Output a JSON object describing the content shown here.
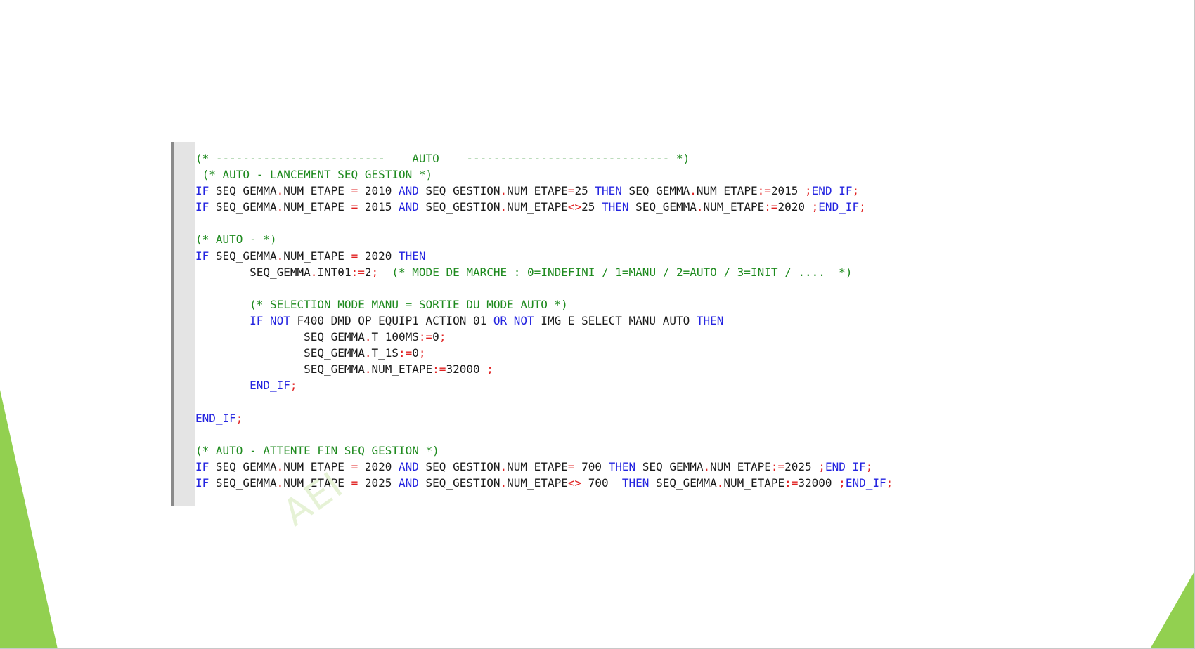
{
  "watermark": "AEI",
  "code_lines": [
    [
      {
        "t": "(* -------------------------    AUTO    ------------------------------ *)",
        "s": "c"
      }
    ],
    [
      {
        "t": " (* AUTO - LANCEMENT SEQ_GESTION *)",
        "s": "c"
      }
    ],
    [
      {
        "t": "IF",
        "s": "k"
      },
      {
        "t": " SEQ_GEMMA",
        "s": "t"
      },
      {
        "t": ".",
        "s": "o"
      },
      {
        "t": "NUM_ETAPE ",
        "s": "t"
      },
      {
        "t": "=",
        "s": "o"
      },
      {
        "t": " 2010 ",
        "s": "t"
      },
      {
        "t": "AND",
        "s": "k"
      },
      {
        "t": " SEQ_GESTION",
        "s": "t"
      },
      {
        "t": ".",
        "s": "o"
      },
      {
        "t": "NUM_ETAPE",
        "s": "t"
      },
      {
        "t": "=",
        "s": "o"
      },
      {
        "t": "25 ",
        "s": "t"
      },
      {
        "t": "THEN",
        "s": "k"
      },
      {
        "t": " SEQ_GEMMA",
        "s": "t"
      },
      {
        "t": ".",
        "s": "o"
      },
      {
        "t": "NUM_ETAPE",
        "s": "t"
      },
      {
        "t": ":=",
        "s": "o"
      },
      {
        "t": "2015 ",
        "s": "t"
      },
      {
        "t": ";",
        "s": "o"
      },
      {
        "t": "END_IF",
        "s": "k"
      },
      {
        "t": ";",
        "s": "o"
      }
    ],
    [
      {
        "t": "IF",
        "s": "k"
      },
      {
        "t": " SEQ_GEMMA",
        "s": "t"
      },
      {
        "t": ".",
        "s": "o"
      },
      {
        "t": "NUM_ETAPE ",
        "s": "t"
      },
      {
        "t": "=",
        "s": "o"
      },
      {
        "t": " 2015 ",
        "s": "t"
      },
      {
        "t": "AND",
        "s": "k"
      },
      {
        "t": " SEQ_GESTION",
        "s": "t"
      },
      {
        "t": ".",
        "s": "o"
      },
      {
        "t": "NUM_ETAPE",
        "s": "t"
      },
      {
        "t": "<>",
        "s": "o"
      },
      {
        "t": "25 ",
        "s": "t"
      },
      {
        "t": "THEN",
        "s": "k"
      },
      {
        "t": " SEQ_GEMMA",
        "s": "t"
      },
      {
        "t": ".",
        "s": "o"
      },
      {
        "t": "NUM_ETAPE",
        "s": "t"
      },
      {
        "t": ":=",
        "s": "o"
      },
      {
        "t": "2020 ",
        "s": "t"
      },
      {
        "t": ";",
        "s": "o"
      },
      {
        "t": "END_IF",
        "s": "k"
      },
      {
        "t": ";",
        "s": "o"
      }
    ],
    [],
    [
      {
        "t": "(* AUTO - *)",
        "s": "c"
      }
    ],
    [
      {
        "t": "IF",
        "s": "k"
      },
      {
        "t": " SEQ_GEMMA",
        "s": "t"
      },
      {
        "t": ".",
        "s": "o"
      },
      {
        "t": "NUM_ETAPE ",
        "s": "t"
      },
      {
        "t": "=",
        "s": "o"
      },
      {
        "t": " 2020 ",
        "s": "t"
      },
      {
        "t": "THEN",
        "s": "k"
      }
    ],
    [
      {
        "t": "        SEQ_GEMMA",
        "s": "t"
      },
      {
        "t": ".",
        "s": "o"
      },
      {
        "t": "INT01",
        "s": "t"
      },
      {
        "t": ":=",
        "s": "o"
      },
      {
        "t": "2",
        "s": "t"
      },
      {
        "t": ";",
        "s": "o"
      },
      {
        "t": "  (* MODE DE MARCHE : 0=INDEFINI / 1=MANU / 2=AUTO / 3=INIT / ....  *)",
        "s": "c"
      }
    ],
    [],
    [
      {
        "t": "        (* SELECTION MODE MANU = SORTIE DU MODE AUTO *)",
        "s": "c"
      }
    ],
    [
      {
        "t": "        IF",
        "s": "k"
      },
      {
        "t": " ",
        "s": "t"
      },
      {
        "t": "NOT",
        "s": "k"
      },
      {
        "t": " F400_DMD_OP_EQUIP1_ACTION_01 ",
        "s": "t"
      },
      {
        "t": "OR",
        "s": "k"
      },
      {
        "t": " ",
        "s": "t"
      },
      {
        "t": "NOT",
        "s": "k"
      },
      {
        "t": " IMG_E_SELECT_MANU_AUTO ",
        "s": "t"
      },
      {
        "t": "THEN",
        "s": "k"
      }
    ],
    [
      {
        "t": "                SEQ_GEMMA",
        "s": "t"
      },
      {
        "t": ".",
        "s": "o"
      },
      {
        "t": "T_100MS",
        "s": "t"
      },
      {
        "t": ":=",
        "s": "o"
      },
      {
        "t": "0",
        "s": "t"
      },
      {
        "t": ";",
        "s": "o"
      }
    ],
    [
      {
        "t": "                SEQ_GEMMA",
        "s": "t"
      },
      {
        "t": ".",
        "s": "o"
      },
      {
        "t": "T_1S",
        "s": "t"
      },
      {
        "t": ":=",
        "s": "o"
      },
      {
        "t": "0",
        "s": "t"
      },
      {
        "t": ";",
        "s": "o"
      }
    ],
    [
      {
        "t": "                SEQ_GEMMA",
        "s": "t"
      },
      {
        "t": ".",
        "s": "o"
      },
      {
        "t": "NUM_ETAPE",
        "s": "t"
      },
      {
        "t": ":=",
        "s": "o"
      },
      {
        "t": "32000 ",
        "s": "t"
      },
      {
        "t": ";",
        "s": "o"
      }
    ],
    [
      {
        "t": "        END_IF",
        "s": "k"
      },
      {
        "t": ";",
        "s": "o"
      }
    ],
    [],
    [
      {
        "t": "END_IF",
        "s": "k"
      },
      {
        "t": ";",
        "s": "o"
      }
    ],
    [],
    [
      {
        "t": "(* AUTO - ATTENTE FIN SEQ_GESTION *)",
        "s": "c"
      }
    ],
    [
      {
        "t": "IF",
        "s": "k"
      },
      {
        "t": " SEQ_GEMMA",
        "s": "t"
      },
      {
        "t": ".",
        "s": "o"
      },
      {
        "t": "NUM_ETAPE ",
        "s": "t"
      },
      {
        "t": "=",
        "s": "o"
      },
      {
        "t": " 2020 ",
        "s": "t"
      },
      {
        "t": "AND",
        "s": "k"
      },
      {
        "t": " SEQ_GESTION",
        "s": "t"
      },
      {
        "t": ".",
        "s": "o"
      },
      {
        "t": "NUM_ETAPE",
        "s": "t"
      },
      {
        "t": "=",
        "s": "o"
      },
      {
        "t": " 700 ",
        "s": "t"
      },
      {
        "t": "THEN",
        "s": "k"
      },
      {
        "t": " SEQ_GEMMA",
        "s": "t"
      },
      {
        "t": ".",
        "s": "o"
      },
      {
        "t": "NUM_ETAPE",
        "s": "t"
      },
      {
        "t": ":=",
        "s": "o"
      },
      {
        "t": "2025 ",
        "s": "t"
      },
      {
        "t": ";",
        "s": "o"
      },
      {
        "t": "END_IF",
        "s": "k"
      },
      {
        "t": ";",
        "s": "o"
      }
    ],
    [
      {
        "t": "IF",
        "s": "k"
      },
      {
        "t": " SEQ_GEMMA",
        "s": "t"
      },
      {
        "t": ".",
        "s": "o"
      },
      {
        "t": "NUM_ETAPE ",
        "s": "t"
      },
      {
        "t": "=",
        "s": "o"
      },
      {
        "t": " 2025 ",
        "s": "t"
      },
      {
        "t": "AND",
        "s": "k"
      },
      {
        "t": " SEQ_GESTION",
        "s": "t"
      },
      {
        "t": ".",
        "s": "o"
      },
      {
        "t": "NUM_ETAPE",
        "s": "t"
      },
      {
        "t": "<>",
        "s": "o"
      },
      {
        "t": " 700  ",
        "s": "t"
      },
      {
        "t": "THEN",
        "s": "k"
      },
      {
        "t": " SEQ_GEMMA",
        "s": "t"
      },
      {
        "t": ".",
        "s": "o"
      },
      {
        "t": "NUM_ETAPE",
        "s": "t"
      },
      {
        "t": ":=",
        "s": "o"
      },
      {
        "t": "32000 ",
        "s": "t"
      },
      {
        "t": ";",
        "s": "o"
      },
      {
        "t": "END_IF",
        "s": "k"
      },
      {
        "t": ";",
        "s": "o"
      }
    ]
  ],
  "colors": {
    "comment": "#1e8a1e",
    "keyword": "#2424e0",
    "operator": "#e02020",
    "text": "#1a1a1a",
    "accent_green": "#92d050"
  }
}
